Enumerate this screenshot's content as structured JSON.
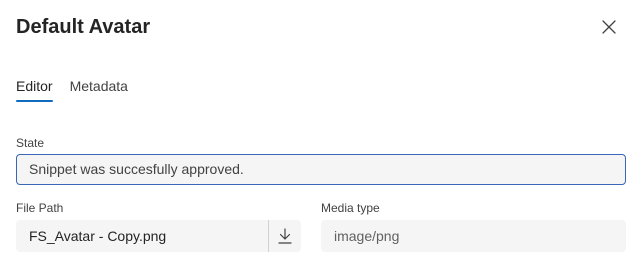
{
  "dialog": {
    "title": "Default Avatar",
    "close_icon": "close-icon"
  },
  "tabs": [
    {
      "label": "Editor",
      "active": true
    },
    {
      "label": "Metadata",
      "active": false
    }
  ],
  "state": {
    "label": "State",
    "value": "Snippet was succesfully approved."
  },
  "file_path": {
    "label": "File Path",
    "value": "FS_Avatar - Copy.png",
    "download_icon": "download-icon"
  },
  "media_type": {
    "label": "Media type",
    "value": "image/png"
  },
  "colors": {
    "accent": "#0f6cbd",
    "field_bg": "#f5f5f5",
    "state_border": "#3a66b8"
  }
}
